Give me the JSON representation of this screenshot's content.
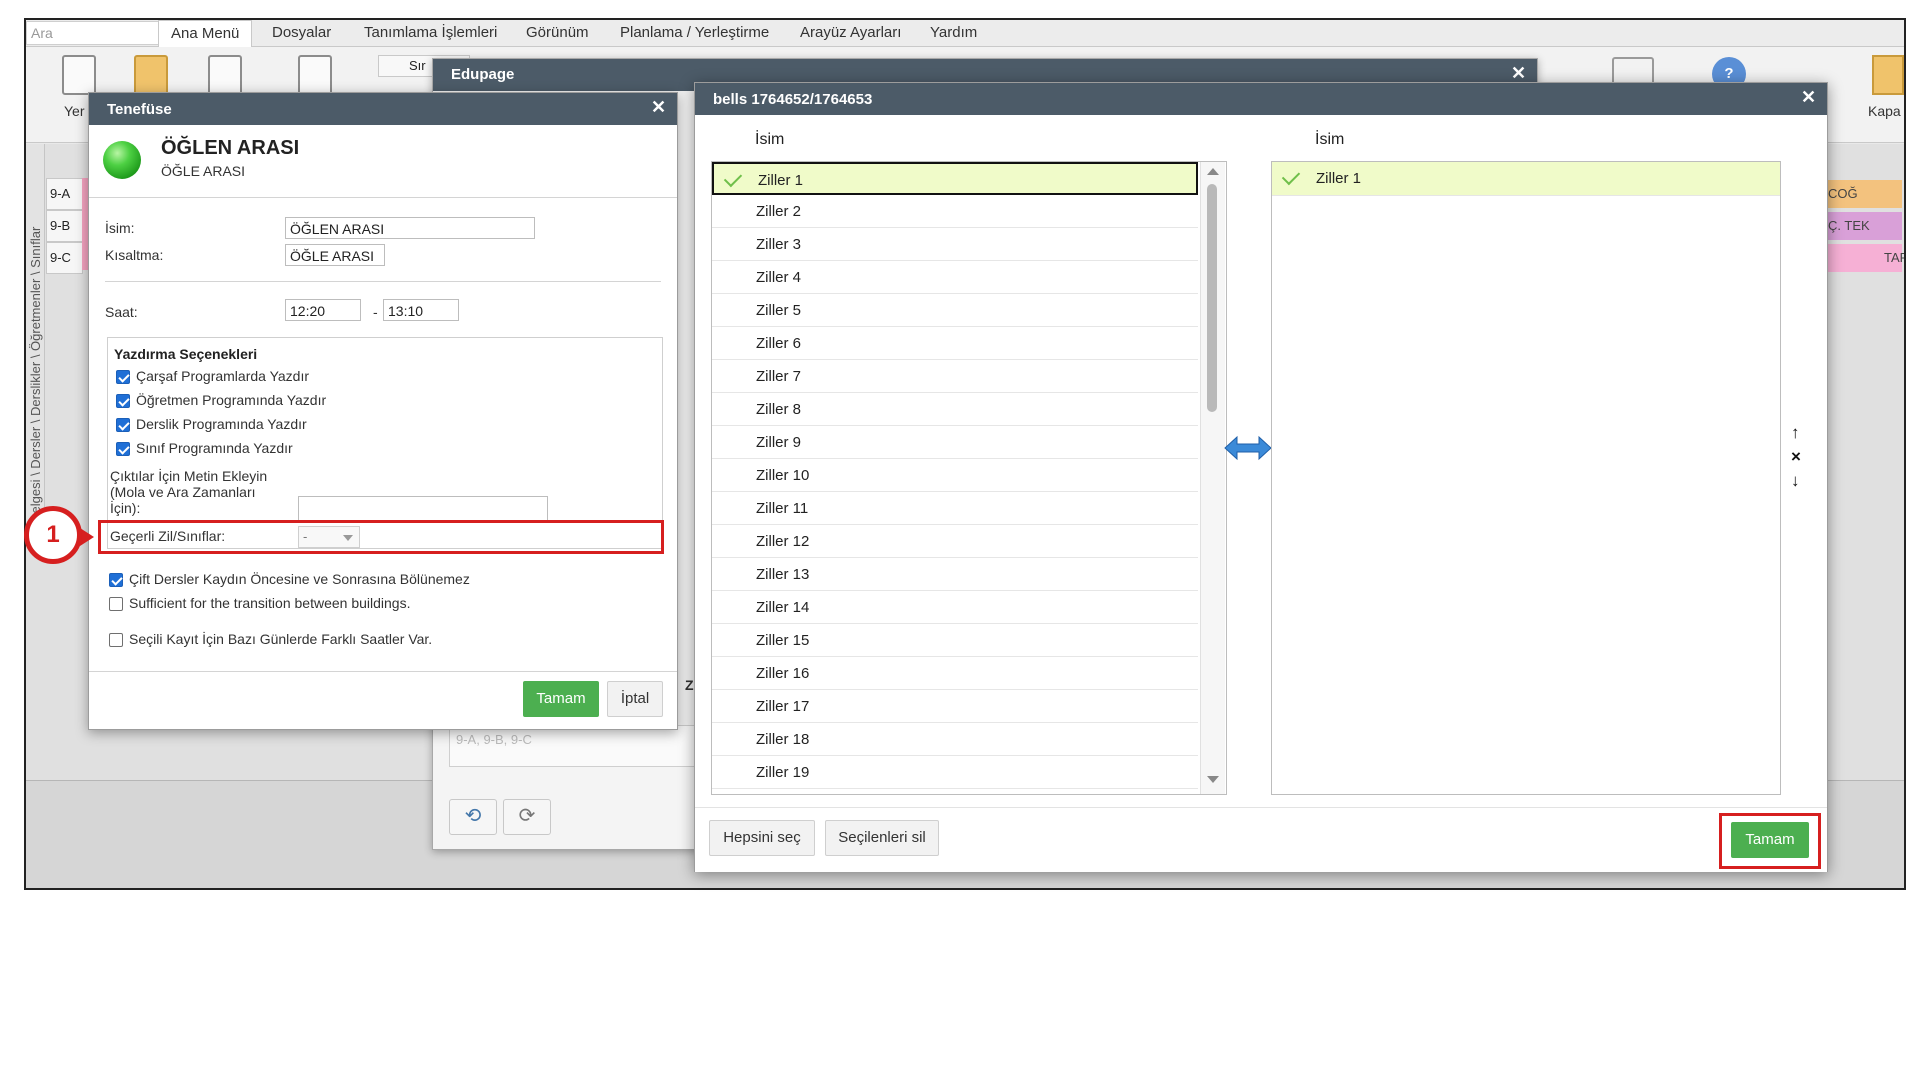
{
  "menubar": {
    "search_placeholder": "Ara",
    "items": [
      "Ana Menü",
      "Dosyalar",
      "Tanımlama İşlemleri",
      "Görünüm",
      "Planlama / Yerleştirme",
      "Arayüz Ayarları",
      "Yardım"
    ]
  },
  "ribbon": {
    "left_label": "Yer",
    "right_label": "Kapa",
    "partial_button": "Sır"
  },
  "timetable": {
    "side_tabs_text": "zelgesi \\ Dersler \\ Derslikler \\ Öğretmenler \\ Sınıflar",
    "rows": [
      "9-A",
      "9-B",
      "9-C"
    ],
    "right_cells": [
      "COĞ",
      "Ç. TEK",
      "TAF"
    ]
  },
  "edupage": {
    "title": "Edupage",
    "classes_text": "9-A, 9-B, 9-C",
    "partial_label": "Zi"
  },
  "tenefuse": {
    "title": "Tenefüse",
    "name": "ÖĞLEN ARASI",
    "subname": "ÖĞLE ARASI",
    "isim_label": "İsim:",
    "isim_value": "ÖĞLEN ARASI",
    "kisaltma_label": "Kısaltma:",
    "kisaltma_value": "ÖĞLE ARASI",
    "saat_label": "Saat:",
    "saat_start": "12:20",
    "saat_sep": "-",
    "saat_end": "13:10",
    "print_title": "Yazdırma Seçenekleri",
    "print_options": [
      {
        "label": "Çarşaf Programlarda Yazdır",
        "checked": true
      },
      {
        "label": "Öğretmen Programında Yazdır",
        "checked": true
      },
      {
        "label": "Derslik Programında Yazdır",
        "checked": true
      },
      {
        "label": "Sınıf Programında Yazdır",
        "checked": true
      }
    ],
    "text_note_label_1": "Çıktılar İçin Metin Ekleyin",
    "text_note_label_2": "(Mola ve Ara Zamanları",
    "text_note_label_3": "İçin):",
    "text_note_value": "",
    "bells_label": "Geçerli Zil/Sınıflar:",
    "bells_value": "-",
    "options": [
      {
        "label": "Çift Dersler Kaydın Öncesine ve Sonrasına Bölünemez",
        "checked": true
      },
      {
        "label": "Sufficient for the transition between buildings.",
        "checked": false
      },
      {
        "label": "Seçili Kayıt İçin Bazı Günlerde Farklı Saatler Var.",
        "checked": false
      }
    ],
    "ok_label": "Tamam",
    "cancel_label": "İptal"
  },
  "annotation": {
    "step_number": "1",
    "highlight_color": "#d61f1f"
  },
  "bells": {
    "title": "bells 1764652/1764653",
    "left_header": "İsim",
    "right_header": "İsim",
    "left_items": [
      "Ziller 1",
      "Ziller 2",
      "Ziller 3",
      "Ziller 4",
      "Ziller 5",
      "Ziller 6",
      "Ziller 7",
      "Ziller 8",
      "Ziller 9",
      "Ziller 10",
      "Ziller 11",
      "Ziller 12",
      "Ziller 13",
      "Ziller 14",
      "Ziller 15",
      "Ziller 16",
      "Ziller 17",
      "Ziller 18",
      "Ziller 19"
    ],
    "selected_left": "Ziller 1",
    "right_items": [
      "Ziller 1"
    ],
    "select_all_label": "Hepsini seç",
    "delete_selected_label": "Seçilenleri sil",
    "ok_label": "Tamam",
    "order_up": "↑",
    "order_remove": "×",
    "order_down": "↓"
  },
  "colors": {
    "dialog_header": "#4c5b68",
    "ok_green": "#4caf50",
    "selection_bg": "#f0fbc9",
    "annotation_red": "#d61f1f",
    "checkbox_blue": "#1f6fd6"
  },
  "icons": [
    "close-icon",
    "swap-arrows-icon",
    "check-icon",
    "undo-icon",
    "redo-icon"
  ]
}
